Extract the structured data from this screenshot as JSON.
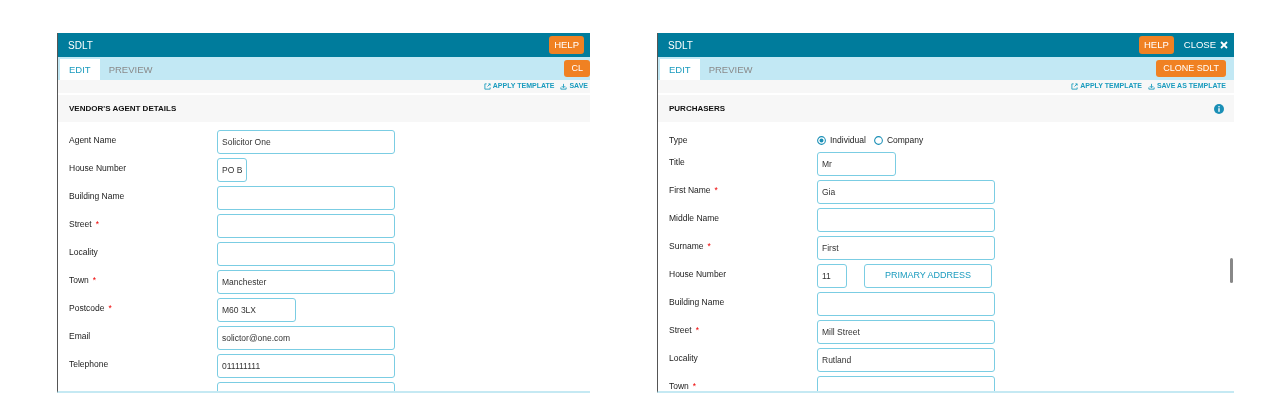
{
  "panels": [
    {
      "title": "SDLT",
      "help_label": "HELP",
      "tabs": [
        {
          "label": "EDIT",
          "selected": true
        },
        {
          "label": "PREVIEW",
          "selected": false
        }
      ],
      "clone_label": "CL",
      "actions": [
        {
          "kind": "apply",
          "label": "APPLY TEMPLATE"
        },
        {
          "kind": "save",
          "label": "SAVE"
        }
      ],
      "section_title": "VENDOR'S AGENT DETAILS",
      "fields": [
        {
          "kind": "text",
          "label": "Agent Name",
          "value": "Solicitor One"
        },
        {
          "kind": "tiny",
          "label": "House Number",
          "value": "PO B"
        },
        {
          "kind": "text",
          "label": "Building Name"
        },
        {
          "kind": "text",
          "label": "Street",
          "required_mark": "*"
        },
        {
          "kind": "text",
          "label": "Locality"
        },
        {
          "kind": "text",
          "label": "Town",
          "required_mark": "*",
          "value": "Manchester"
        },
        {
          "kind": "short",
          "label": "Postcode",
          "required_mark": "*",
          "value": "M60 3LX"
        },
        {
          "kind": "text",
          "label": "Email",
          "value": "solictor@one.com"
        },
        {
          "kind": "text",
          "label": "Telephone",
          "value": "011111111"
        },
        {
          "kind": "text"
        }
      ]
    },
    {
      "title": "SDLT",
      "help_label": "HELP",
      "close_label": "CLOSE",
      "tabs": [
        {
          "label": "EDIT",
          "selected": true
        },
        {
          "label": "PREVIEW",
          "selected": false
        }
      ],
      "clone_label": "CLONE SDLT",
      "actions": [
        {
          "kind": "apply",
          "label": "APPLY TEMPLATE"
        },
        {
          "kind": "save",
          "label": "SAVE AS TEMPLATE"
        }
      ],
      "section_title": "PURCHASERS",
      "info": true,
      "scrollbar": true,
      "fields": [
        {
          "kind": "radio",
          "label": "Type",
          "options": [
            {
              "label": "Individual",
              "selected": true
            },
            {
              "label": "Company",
              "selected": false
            }
          ]
        },
        {
          "kind": "short",
          "label": "Title",
          "value": "Mr"
        },
        {
          "kind": "text",
          "label": "First Name",
          "required_mark": "*",
          "value": "Gia"
        },
        {
          "kind": "text",
          "label": "Middle Name"
        },
        {
          "kind": "text",
          "label": "Surname",
          "required_mark": "*",
          "value": "First"
        },
        {
          "kind": "tiny_button",
          "label": "House Number",
          "value": "11",
          "button": "PRIMARY ADDRESS"
        },
        {
          "kind": "text",
          "label": "Building Name"
        },
        {
          "kind": "text",
          "label": "Street",
          "required_mark": "*",
          "value": "Mill Street"
        },
        {
          "kind": "text",
          "label": "Locality",
          "value": "Rutland"
        },
        {
          "kind": "text",
          "label": "Town",
          "required_mark": "*"
        }
      ]
    }
  ]
}
